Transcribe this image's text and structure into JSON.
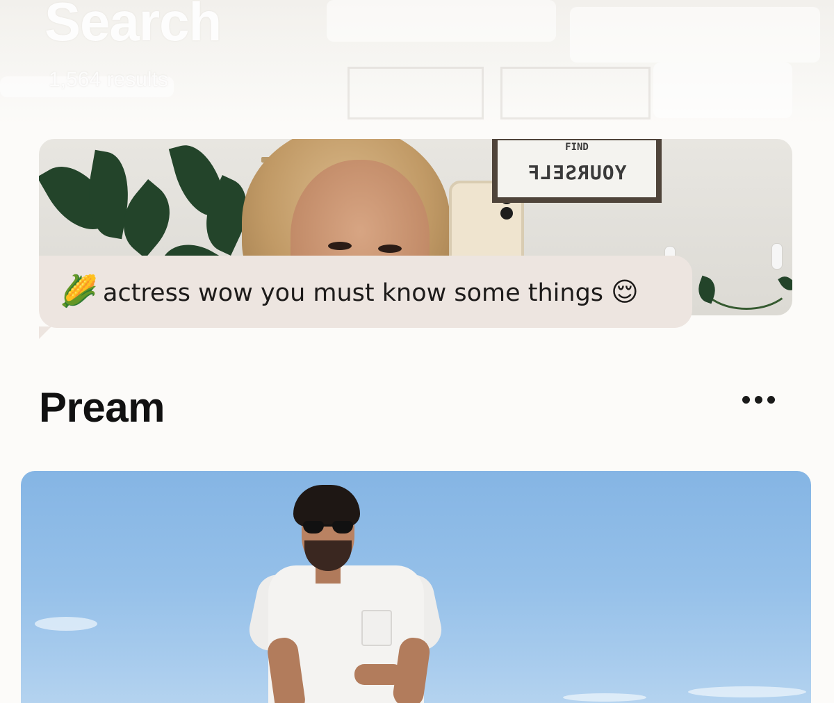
{
  "header": {
    "title": "Search",
    "subtitle": "1,564 results"
  },
  "prompt_card_1": {
    "poster_top": "FIND",
    "poster_text": "YOURSELF",
    "comment": {
      "lead_emoji": "🌽",
      "text": "actress wow you must know some things",
      "trail_emoji": "😌"
    }
  },
  "profile": {
    "name": "Pream",
    "more_label": "•••"
  },
  "icons": {
    "more": "more-horizontal-icon"
  },
  "colors": {
    "background": "#fcfbf9",
    "bubble": "#ede5e0",
    "text": "#111111",
    "sky": "#95c0e9"
  }
}
